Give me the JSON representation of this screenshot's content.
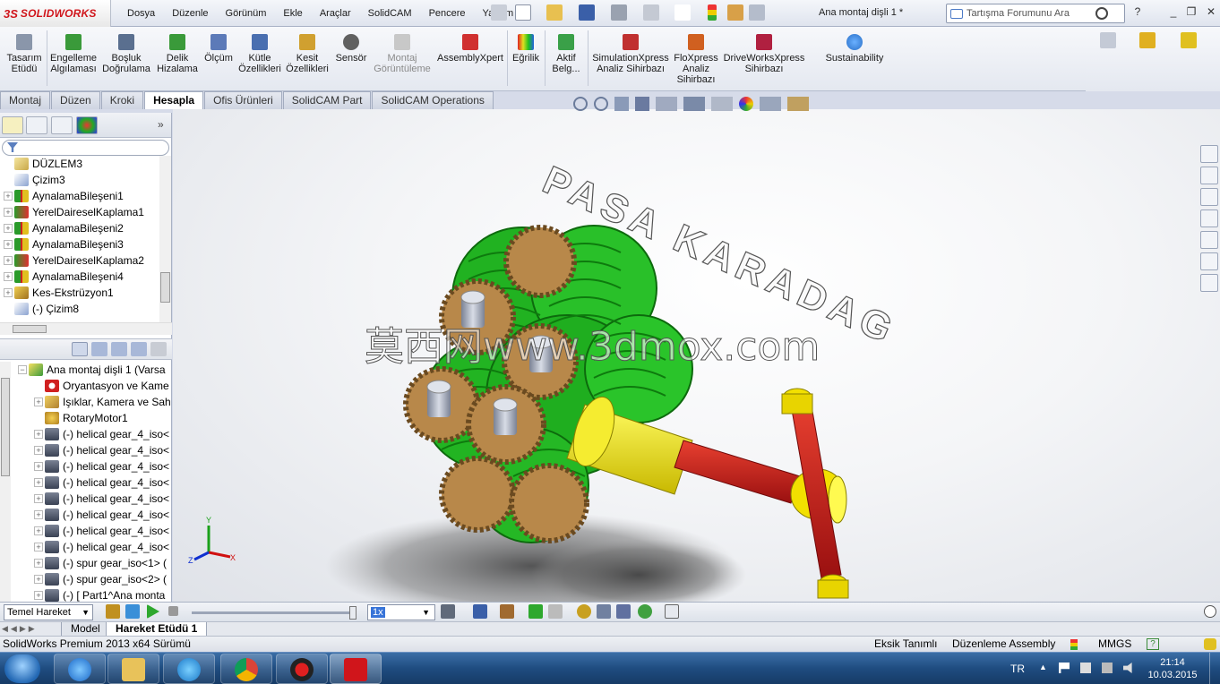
{
  "app": {
    "brand_prefix": "3S",
    "brand_name": "SOLIDWORKS",
    "document_title": "Ana montaj dişli 1 *"
  },
  "menu": [
    "Dosya",
    "Düzenle",
    "Görünüm",
    "Ekle",
    "Araçlar",
    "SolidCAM",
    "Pencere",
    "Yardım"
  ],
  "search": {
    "placeholder": "Tartışma Forumunu Ara"
  },
  "commands": [
    {
      "label1": "Tasarım",
      "label2": "Etüdü",
      "icon": "design-study-icon"
    },
    {
      "label1": "Engelleme",
      "label2": "Algılaması",
      "icon": "interference-detection-icon"
    },
    {
      "label1": "Boşluk",
      "label2": "Doğrulama",
      "icon": "clearance-verification-icon"
    },
    {
      "label1": "Delik",
      "label2": "Hizalama",
      "icon": "hole-alignment-icon"
    },
    {
      "label1": "Ölçüm",
      "label2": "",
      "icon": "measure-icon"
    },
    {
      "label1": "Kütle",
      "label2": "Özellikleri",
      "icon": "mass-properties-icon"
    },
    {
      "label1": "Kesit",
      "label2": "Özellikleri",
      "icon": "section-properties-icon"
    },
    {
      "label1": "Sensör",
      "label2": "",
      "icon": "sensor-icon"
    },
    {
      "label1": "Montaj",
      "label2": "Görüntüleme",
      "icon": "assembly-visualization-icon"
    },
    {
      "label1": "AssemblyXpert",
      "label2": "",
      "icon": "assemblyxpert-icon"
    },
    {
      "label1": "Eğrilik",
      "label2": "",
      "icon": "curvature-icon"
    },
    {
      "label1": "Aktif",
      "label2": "Belg...",
      "icon": "active-document-icon"
    },
    {
      "label1": "SimulationXpress",
      "label2": "Analiz Sihirbazı",
      "icon": "simulationxpress-icon"
    },
    {
      "label1": "FloXpress",
      "label2": "Analiz",
      "label3": "Sihirbazı",
      "icon": "floxpress-icon"
    },
    {
      "label1": "DriveWorksXpress",
      "label2": "Sihirbazı",
      "icon": "driveworksxpress-icon"
    },
    {
      "label1": "Sustainability",
      "label2": "",
      "icon": "sustainability-icon"
    }
  ],
  "tabs": [
    "Montaj",
    "Düzen",
    "Kroki",
    "Hesapla",
    "Ofis Ürünleri",
    "SolidCAM Part",
    "SolidCAM Operations"
  ],
  "active_tab": "Hesapla",
  "feature_tree_top": [
    {
      "label": "DÜZLEM3",
      "icon": "plane-icon"
    },
    {
      "label": "Çizim3",
      "icon": "sketch-icon"
    },
    {
      "label": "AynalamaBileşeni1",
      "icon": "mirror-component-icon"
    },
    {
      "label": "YerelDaireselKaplama1",
      "icon": "circular-pattern-icon"
    },
    {
      "label": "AynalamaBileşeni2",
      "icon": "mirror-component-icon"
    },
    {
      "label": "AynalamaBileşeni3",
      "icon": "mirror-component-icon"
    },
    {
      "label": "YerelDaireselKaplama2",
      "icon": "circular-pattern-icon"
    },
    {
      "label": "AynalamaBileşeni4",
      "icon": "mirror-component-icon"
    },
    {
      "label": "Kes-Ekstrüzyon1",
      "icon": "cut-extrude-icon"
    },
    {
      "label": "(-) Çizim8",
      "icon": "sketch-icon"
    }
  ],
  "feature_tree_bottom": [
    {
      "label": "Ana montaj dişli 1  (Varsa",
      "icon": "assembly-icon"
    },
    {
      "label": "Oryantasyon ve Kame",
      "icon": "orientation-icon"
    },
    {
      "label": "Işıklar, Kamera ve Sah",
      "icon": "lights-icon"
    },
    {
      "label": "RotaryMotor1",
      "icon": "rotary-motor-icon"
    },
    {
      "label": "(-) helical gear_4_iso<",
      "icon": "part-icon"
    },
    {
      "label": "(-) helical gear_4_iso<",
      "icon": "part-icon"
    },
    {
      "label": "(-) helical gear_4_iso<",
      "icon": "part-icon"
    },
    {
      "label": "(-) helical gear_4_iso<",
      "icon": "part-icon"
    },
    {
      "label": "(-) helical gear_4_iso<",
      "icon": "part-icon"
    },
    {
      "label": "(-) helical gear_4_iso<",
      "icon": "part-icon"
    },
    {
      "label": "(-) helical gear_4_iso<",
      "icon": "part-icon"
    },
    {
      "label": "(-) helical gear_4_iso<",
      "icon": "part-icon"
    },
    {
      "label": "(-) spur gear_iso<1> (",
      "icon": "part-icon"
    },
    {
      "label": "(-) spur gear_iso<2> (",
      "icon": "part-icon"
    },
    {
      "label": "(-) [ Part1^Ana monta",
      "icon": "part-icon"
    }
  ],
  "viewport": {
    "engraved_text": "PASA KARADAG",
    "watermark": "莫西网www.3dmox.com",
    "triad_labels": [
      "Y",
      "X",
      "Z"
    ]
  },
  "motion": {
    "study_type": "Temel Hareket",
    "speed": "1x"
  },
  "bottom_tabs": [
    "Model",
    "Hareket Etüdü 1"
  ],
  "status": {
    "version": "SolidWorks Premium 2013 x64 Sürümü",
    "defined": "Eksik Tanımlı",
    "mode": "Düzenleme Assembly",
    "units": "MMGS"
  },
  "tray": {
    "language": "TR",
    "time": "21:14",
    "date": "10.03.2015"
  },
  "colors": {
    "brand_red": "#d0151b",
    "gear_green": "#22b422",
    "gear_bronze": "#b8884a",
    "shaft_red": "#d0241c",
    "shaft_yellow": "#f2e000",
    "taskbar_blue": "#1f4c80"
  }
}
